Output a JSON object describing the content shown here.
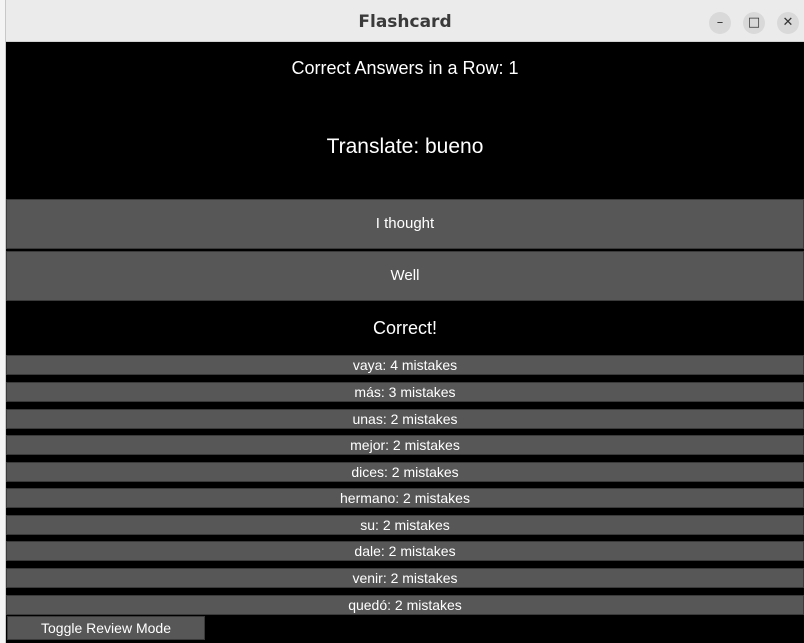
{
  "window": {
    "title": "Flashcard",
    "controls": {
      "minimize": "–",
      "maximize": "□",
      "close": "✕"
    }
  },
  "card": {
    "streak_text": "Correct Answers in a Row: 1",
    "prompt_text": "Translate: bueno",
    "answers": [
      "I thought",
      "Well"
    ],
    "feedback_text": "Correct!"
  },
  "mistakes": [
    "vaya: 4 mistakes",
    "más: 3 mistakes",
    "unas: 2 mistakes",
    "mejor: 2 mistakes",
    "dices: 2 mistakes",
    "hermano: 2 mistakes",
    "su: 2 mistakes",
    "dale: 2 mistakes",
    "venir: 2 mistakes",
    "quedó: 2 mistakes"
  ],
  "footer": {
    "toggle_label": "Toggle Review Mode"
  },
  "colors": {
    "background": "#000000",
    "button": "#575757",
    "text": "#ffffff",
    "titlebar": "#ebebeb"
  }
}
